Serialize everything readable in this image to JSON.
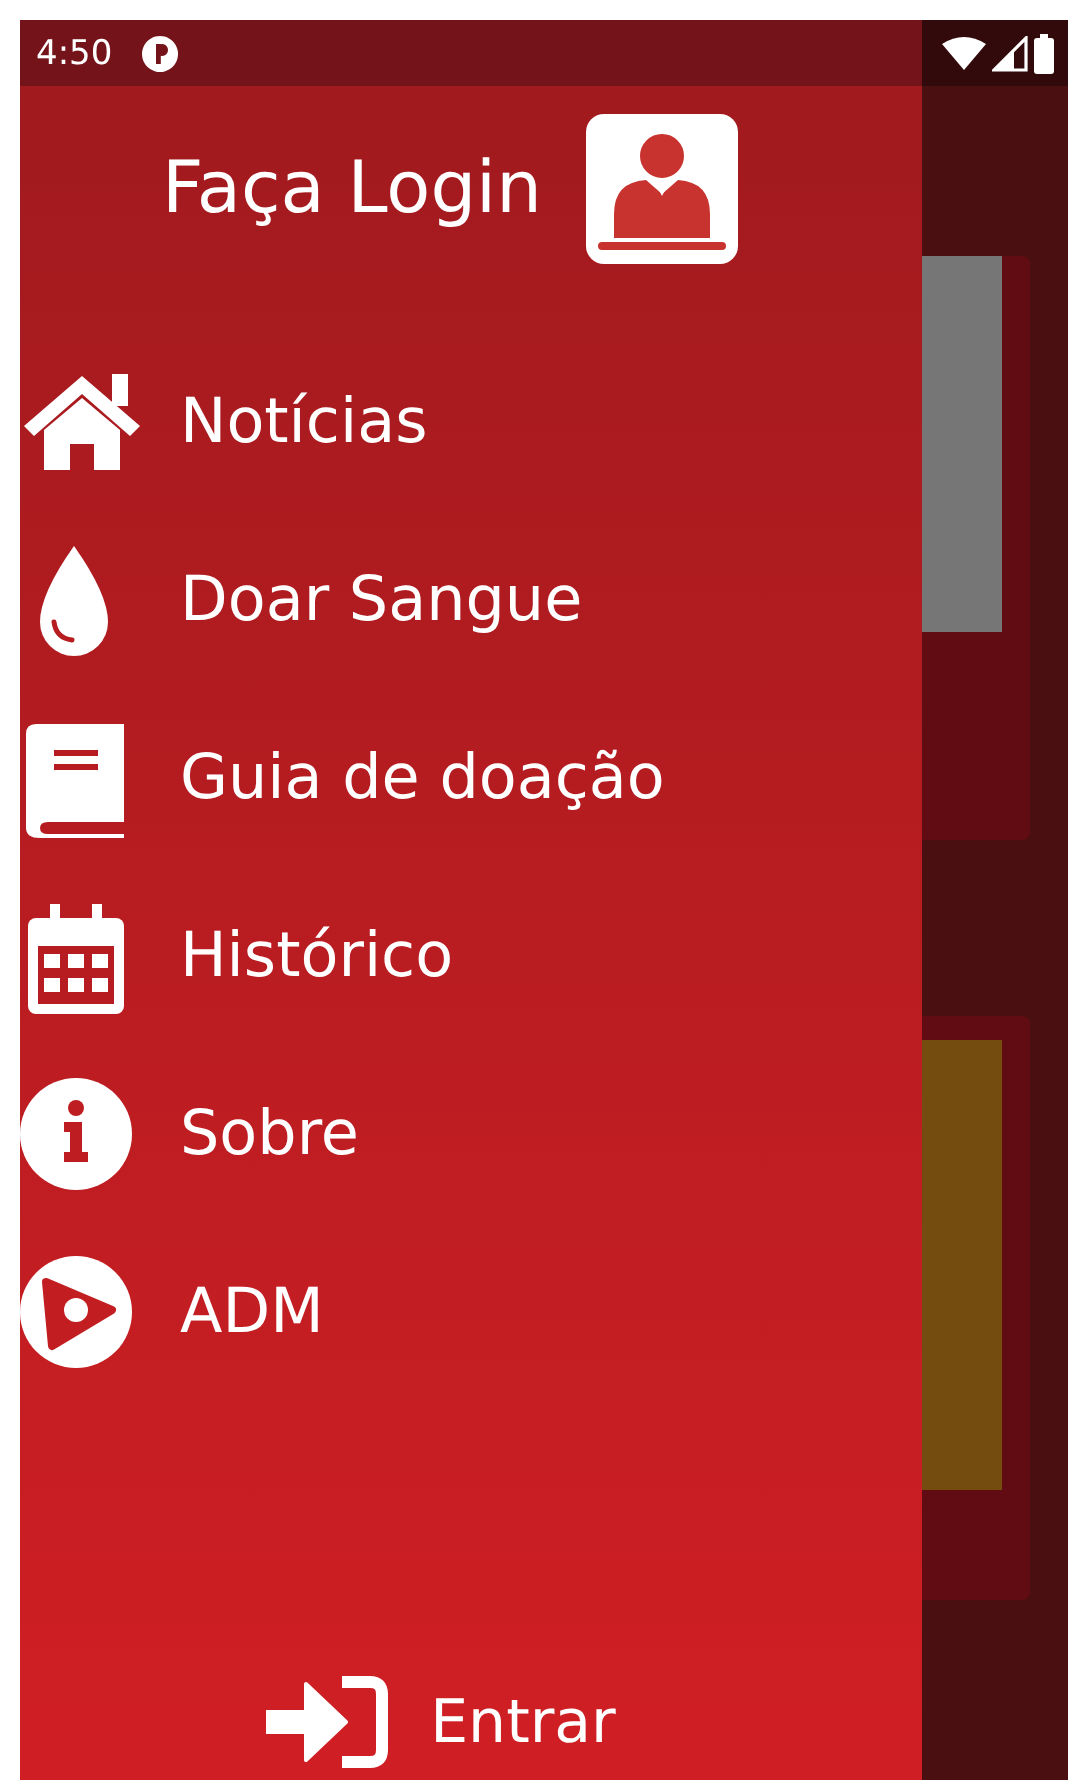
{
  "status_bar": {
    "time": "4:50"
  },
  "drawer": {
    "header": {
      "title": "Faça Login"
    },
    "items": [
      {
        "kind": "home",
        "label": "Notícias"
      },
      {
        "kind": "drop",
        "label": "Doar Sangue"
      },
      {
        "kind": "book",
        "label": "Guia de doação"
      },
      {
        "kind": "calendar",
        "label": "Histórico"
      },
      {
        "kind": "info",
        "label": "Sobre"
      },
      {
        "kind": "play",
        "label": "ADM"
      }
    ],
    "footer_button": {
      "label": "Entrar"
    }
  }
}
